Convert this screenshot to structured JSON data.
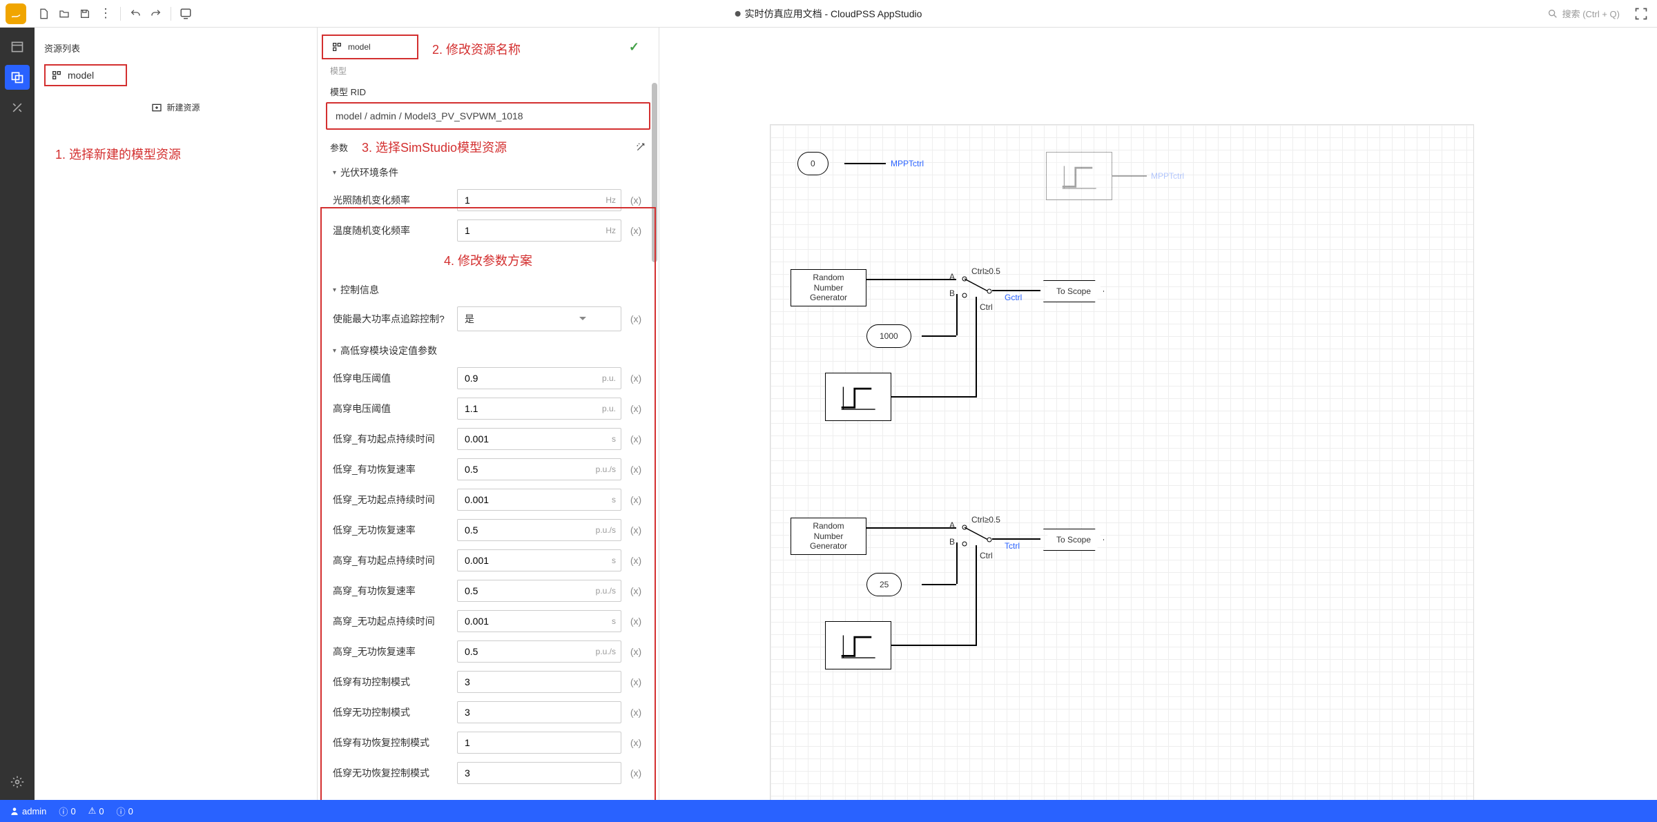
{
  "topbar": {
    "title": "实时仿真应用文档 - CloudPSS AppStudio",
    "search_placeholder": "搜索 (Ctrl + Q)"
  },
  "panel1": {
    "header": "资源列表",
    "item_model": "model",
    "new_resource": "新建资源"
  },
  "annotations": {
    "a1": "1.  选择新建的模型资源",
    "a2": "2.  修改资源名称",
    "a3": "3.  选择SimStudio模型资源",
    "a4": "4.  修改参数方案"
  },
  "panel2": {
    "model_name": "model",
    "model_sub": "模型",
    "rid_label": "模型 RID",
    "rid_value": "model / admin / Model3_PV_SVPWM_1018",
    "params_label": "参数",
    "groups": {
      "g1": "光伏环境条件",
      "g2": "控制信息",
      "g3": "高低穿模块设定值参数"
    },
    "p_light_freq": {
      "label": "光照随机变化频率",
      "value": "1",
      "unit": "Hz"
    },
    "p_temp_freq": {
      "label": "温度随机变化频率",
      "value": "1",
      "unit": "Hz"
    },
    "p_mppt": {
      "label": "使能最大功率点追踪控制?",
      "value": "是"
    },
    "p_low_v": {
      "label": "低穿电压阈值",
      "value": "0.9",
      "unit": "p.u."
    },
    "p_high_v": {
      "label": "高穿电压阈值",
      "value": "1.1",
      "unit": "p.u."
    },
    "p_low_ap_start": {
      "label": "低穿_有功起点持续时间",
      "value": "0.001",
      "unit": "s"
    },
    "p_low_ap_rec": {
      "label": "低穿_有功恢复速率",
      "value": "0.5",
      "unit": "p.u./s"
    },
    "p_low_rp_start": {
      "label": "低穿_无功起点持续时间",
      "value": "0.001",
      "unit": "s"
    },
    "p_low_rp_rec": {
      "label": "低穿_无功恢复速率",
      "value": "0.5",
      "unit": "p.u./s"
    },
    "p_high_ap_start": {
      "label": "高穿_有功起点持续时间",
      "value": "0.001",
      "unit": "s"
    },
    "p_high_ap_rec": {
      "label": "高穿_有功恢复速率",
      "value": "0.5",
      "unit": "p.u./s"
    },
    "p_high_rp_start": {
      "label": "高穿_无功起点持续时间",
      "value": "0.001",
      "unit": "s"
    },
    "p_high_rp_rec": {
      "label": "高穿_无功恢复速率",
      "value": "0.5",
      "unit": "p.u./s"
    },
    "p_low_ap_mode": {
      "label": "低穿有功控制模式",
      "value": "3"
    },
    "p_low_rp_mode": {
      "label": "低穿无功控制模式",
      "value": "3"
    },
    "p_low_ap_rmode": {
      "label": "低穿有功恢复控制模式",
      "value": "1"
    },
    "p_low_rp_rmode": {
      "label": "低穿无功恢复控制模式",
      "value": "3"
    },
    "x": "(x)"
  },
  "canvas": {
    "const0": "0",
    "mppt": "MPPTctrl",
    "mppt_faded": "MPPTctrl",
    "rng": "Random\nNumber\nGenerator",
    "const1000": "1000",
    "const25": "25",
    "toscope": "To Scope",
    "gctrl": "Gctrl",
    "tctrl": "Tctrl",
    "ctrl": "Ctrl",
    "swlabel": "Ctrl≥0.5",
    "a": "A",
    "b": "B"
  },
  "status": {
    "user": "admin",
    "info": "0",
    "warn": "0",
    "err": "0"
  }
}
